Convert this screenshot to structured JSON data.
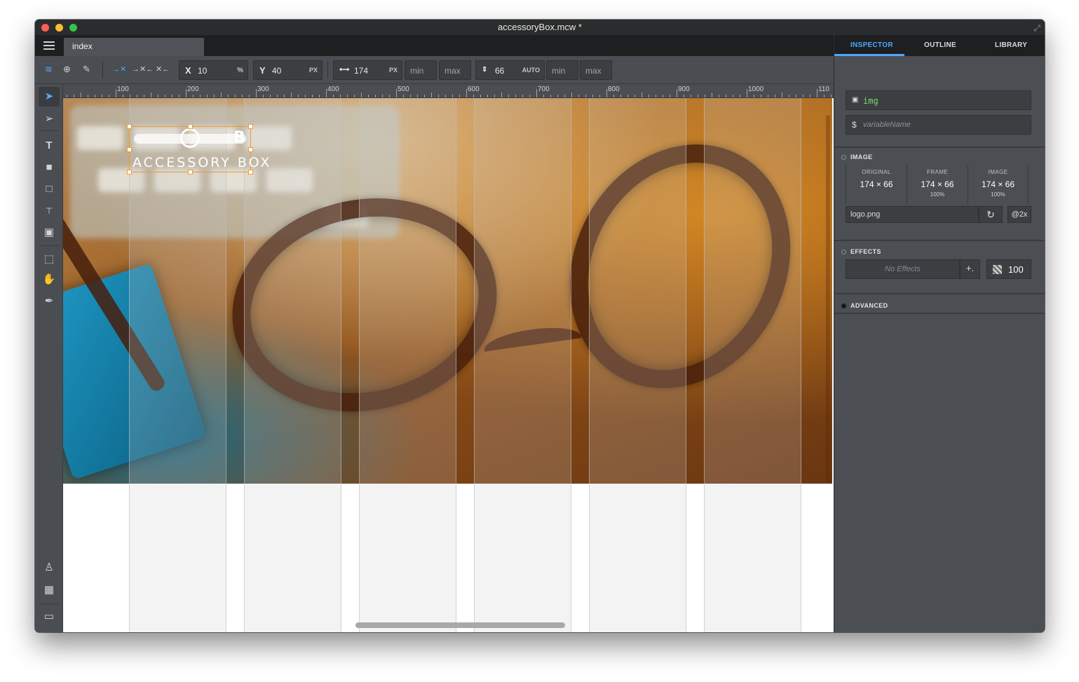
{
  "window": {
    "title": "accessoryBox.mcw *"
  },
  "tabs": [
    {
      "label": "index"
    }
  ],
  "toolbar": {
    "x": {
      "label": "X",
      "value": "10",
      "unit": "%"
    },
    "y": {
      "label": "Y",
      "value": "40",
      "unit": "PX"
    },
    "width": {
      "value": "174",
      "unit": "PX",
      "min_placeholder": "min",
      "max_placeholder": "max"
    },
    "height": {
      "value": "66",
      "unit": "AUTO",
      "min_placeholder": "min",
      "max_placeholder": "max"
    }
  },
  "ruler": {
    "labels": [
      "100",
      "200",
      "300",
      "400",
      "500",
      "600",
      "700",
      "800",
      "900",
      "1000",
      "110"
    ]
  },
  "logo": {
    "text": "ACCESSORY BOX",
    "mark": "B"
  },
  "inspector": {
    "tabs": [
      "INSPECTOR",
      "OUTLINE",
      "LIBRARY"
    ],
    "active_tab": "INSPECTOR",
    "element_type": "img",
    "variable_placeholder": "variableName",
    "image_section": "IMAGE",
    "original": {
      "label": "ORIGINAL",
      "value": "174 × 66"
    },
    "frame": {
      "label": "FRAME",
      "value": "174 × 66",
      "percent": "100%"
    },
    "image": {
      "label": "IMAGE",
      "value": "174 × 66",
      "percent": "100%"
    },
    "file": "logo.png",
    "retina": "@2x",
    "effects_section": "EFFECTS",
    "effects_placeholder": "No Effects",
    "add_effect": "+.",
    "opacity": "100",
    "advanced_section": "ADVANCED"
  },
  "colors": {
    "accent": "#4ea7ff",
    "selection": "#f09a2c",
    "type_text": "#7fd86a"
  }
}
